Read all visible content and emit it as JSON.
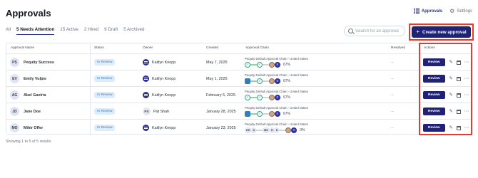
{
  "page_title": "Approvals",
  "top_nav": {
    "approvals_label": "Approvals",
    "settings_label": "Settings"
  },
  "tabs": [
    {
      "label": "All",
      "active": false
    },
    {
      "label": "5 Needs Attention",
      "active": true
    },
    {
      "label": "15 Active",
      "active": false
    },
    {
      "label": "2 Hired",
      "active": false
    },
    {
      "label": "9 Draft",
      "active": false
    },
    {
      "label": "5 Archived",
      "active": false
    }
  ],
  "search": {
    "placeholder": "Search for an approval",
    "value": ""
  },
  "create_button": {
    "label": "Create new approval"
  },
  "columns": [
    "Approval Name",
    "Status",
    "Owner",
    "Created",
    "Approval Chain",
    "Resolved",
    "Actions"
  ],
  "rows": [
    {
      "initials": "PS",
      "name": "Pequity Success",
      "status": "In Review",
      "owner": "Kaitlyn Knopp",
      "owner_initials": "",
      "created": "May 7, 2025",
      "chain": "Pequity Default Approval Chain - United States",
      "progress": "67%",
      "resolved": "--",
      "review": "Review"
    },
    {
      "initials": "EV",
      "name": "Emily Vulpis",
      "status": "In Review",
      "owner": "Kaitlyn Knopp",
      "owner_initials": "",
      "created": "May 1, 2025",
      "chain": "Pequity Default Approval Chain - United States",
      "progress": "67%",
      "resolved": "--",
      "review": "Review"
    },
    {
      "initials": "AG",
      "name": "Abel Gaviria",
      "status": "In Review",
      "owner": "Kaitlyn Knopp",
      "owner_initials": "",
      "created": "February 5, 2025",
      "chain": "Pequity Default Approval Chain - United States",
      "progress": "67%",
      "resolved": "--",
      "review": "Review"
    },
    {
      "initials": "JD",
      "name": "Jane Doe",
      "status": "In Review",
      "owner": "Pat Shah",
      "owner_initials": "PS",
      "created": "January 28, 2025",
      "chain": "Pequity Default Approval Chain - United States",
      "progress": "67%",
      "resolved": "--",
      "review": "Review"
    },
    {
      "initials": "MO",
      "name": "Mihir Offer",
      "status": "In Review",
      "owner": "Kaitlyn Knopp",
      "owner_initials": "",
      "created": "January 23, 2025",
      "chain": "Pequity Default Approval Chain - United States",
      "progress": "0%",
      "resolved": "--",
      "review": "Review"
    }
  ],
  "chain_chips": [
    "DH",
    "S",
    "MK",
    "H",
    "S"
  ],
  "footer_text": "Showing 1 to 5 of 5 results",
  "colors": {
    "primary": "#1f2277",
    "highlight": "#e63b2e",
    "status_bg": "#dcecfb",
    "status_text": "#3c7ab6",
    "done_green": "#2fa873"
  },
  "icons": {
    "grid": "grid-icon",
    "settings": "gear-icon",
    "search": "search-icon",
    "add": "plus-icon",
    "edit": "pencil-icon",
    "archive": "archive-icon",
    "more": "more-icon"
  }
}
